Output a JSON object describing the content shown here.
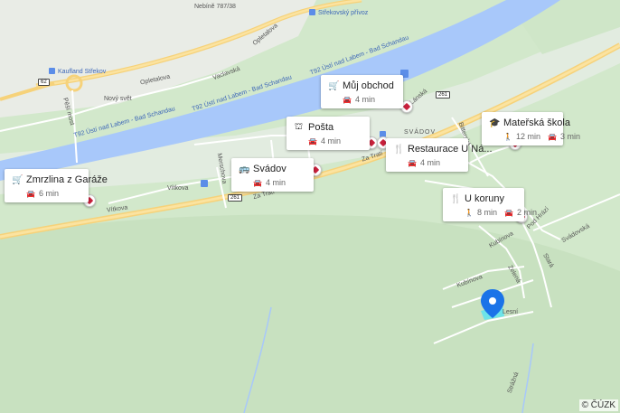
{
  "pois": [
    {
      "id": "muj-obchod",
      "name": "Můj obchod",
      "icon": "shopping-cart-icon",
      "glyph": "🛒",
      "times": [
        {
          "mode": "car",
          "glyph": "🚘",
          "value": "4 min"
        }
      ]
    },
    {
      "id": "posta",
      "name": "Pošta",
      "icon": "post-office-icon",
      "glyph": "⛫",
      "times": [
        {
          "mode": "car",
          "glyph": "🚘",
          "value": "4 min"
        }
      ]
    },
    {
      "id": "restaurace",
      "name": "Restaurace U Ná...",
      "icon": "restaurant-icon",
      "glyph": "🍴",
      "times": [
        {
          "mode": "car",
          "glyph": "🚘",
          "value": "4 min"
        }
      ]
    },
    {
      "id": "materska-skola",
      "name": "Mateřská škola",
      "icon": "school-icon",
      "glyph": "🎓",
      "times": [
        {
          "mode": "walk",
          "glyph": "🚶",
          "value": "12 min"
        },
        {
          "mode": "car",
          "glyph": "🚘",
          "value": "3 min"
        }
      ]
    },
    {
      "id": "svadov",
      "name": "Svádov",
      "icon": "bus-stop-icon",
      "glyph": "🚌",
      "times": [
        {
          "mode": "car",
          "glyph": "🚘",
          "value": "4 min"
        }
      ]
    },
    {
      "id": "zmrzlina",
      "name": "Zmrzlina z Garáže",
      "icon": "shopping-cart-icon",
      "glyph": "🛒",
      "times": [
        {
          "mode": "car",
          "glyph": "🚘",
          "value": "6 min"
        }
      ]
    },
    {
      "id": "u-koruny",
      "name": "U koruny",
      "icon": "restaurant-icon",
      "glyph": "🍴",
      "times": [
        {
          "mode": "walk",
          "glyph": "🚶",
          "value": "8 min"
        },
        {
          "mode": "car",
          "glyph": "🚘",
          "value": "2 min"
        }
      ]
    }
  ],
  "map_labels": {
    "river_1": "T92 Ústí nad Labem - Bad Schandau",
    "river_2": "T92 Ústí nad Labem - Bad Schandau",
    "river_3": "T92 Ústí nad Labem - Bad Schandau",
    "opletalova_1": "Opletalova",
    "opletalova_2": "Opletalova",
    "vaclavska": "Vaclavská",
    "novy_svet": "Nový svět",
    "pesi_most": "Pěší most",
    "kaufland": "Kaufland Střekov",
    "strekovsky_privoz": "Střekovský přívoz",
    "top_address": "Nebíně 787/38",
    "vitkova_1": "Vítkova",
    "vitkova_2": "Vítkova",
    "merschova": "Merschova",
    "za_trati_1": "Za Tratí",
    "za_trati_2": "Za Tratí",
    "svadov_area": "SVÁDOV",
    "lanska": "Lánská",
    "kubinova_1": "Kubínova",
    "kubinova_2": "Kubínova",
    "zelena": "Zelená",
    "stara": "Stará",
    "lesni": "Lesní",
    "pod_hrazi": "Pod Hrází",
    "svadovska": "Svádovská",
    "bitterska": "Bitterská",
    "strazna": "Strážná"
  },
  "road_shields": {
    "r62": "62",
    "r261_a": "261",
    "r261_b": "261"
  },
  "colors": {
    "river": "#9cc0f9",
    "major_road": "#f8d780",
    "minor_road": "#ffffff",
    "urban": "#e8e8e8",
    "park": "#c6e2bd",
    "pin": "#1a73e8"
  },
  "attribution": "© ČÚZK"
}
